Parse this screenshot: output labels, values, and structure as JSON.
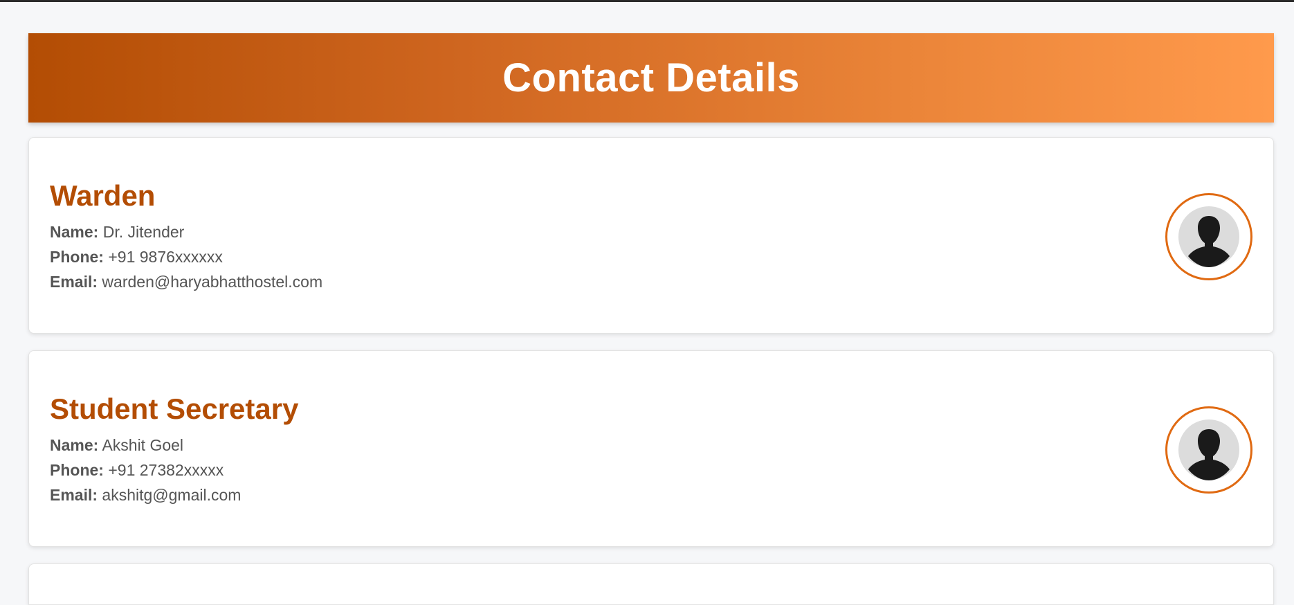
{
  "page": {
    "title": "Contact Details"
  },
  "contacts": [
    {
      "role": "Warden",
      "name_label": "Name:",
      "name": "Dr. Jitender",
      "phone_label": "Phone:",
      "phone": "+91 9876xxxxxx",
      "email_label": "Email:",
      "email": "warden@haryabhatthostel.com",
      "avatar_icon": "person-silhouette-icon"
    },
    {
      "role": "Student Secretary",
      "name_label": "Name:",
      "name": "Akshit Goel",
      "phone_label": "Phone:",
      "phone": "+91 27382xxxxx",
      "email_label": "Email:",
      "email": "akshitg@gmail.com",
      "avatar_icon": "person-silhouette-icon"
    }
  ],
  "colors": {
    "accent": "#b34d04",
    "header_gradient_start": "#b34d04",
    "header_gradient_end": "#ff9a4c",
    "avatar_border": "#e06a12",
    "background": "#f6f7f9"
  }
}
